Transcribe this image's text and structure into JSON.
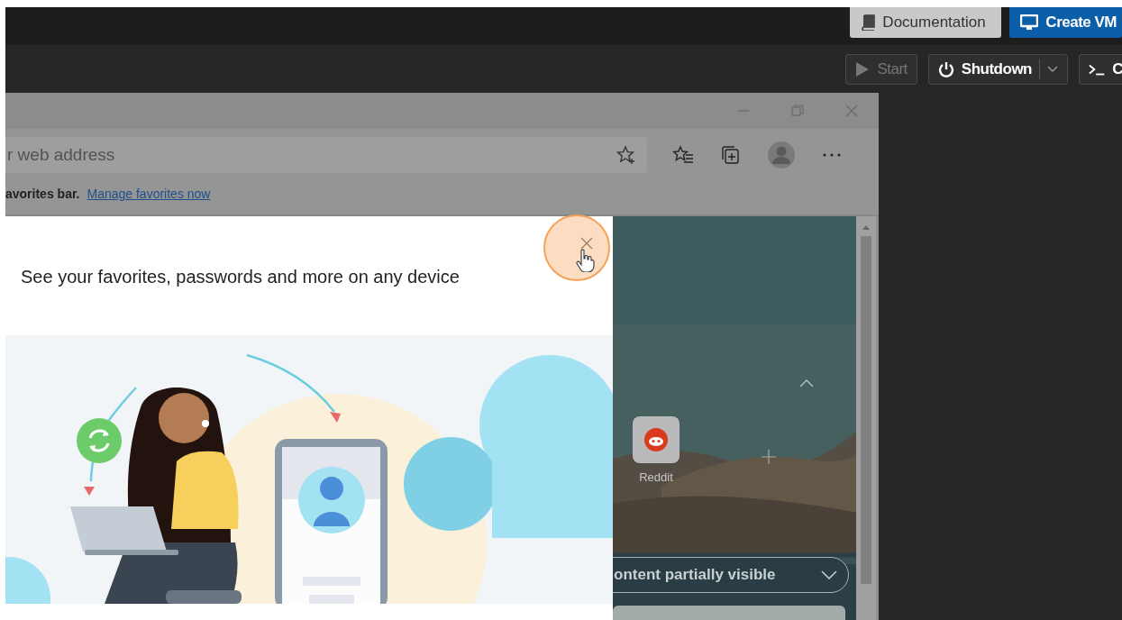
{
  "top_bar": {
    "buttons": [
      {
        "label": "Documentation",
        "kind": "secondary"
      },
      {
        "label": "Create VM",
        "kind": "primary"
      }
    ]
  },
  "toolbar": {
    "buttons": [
      {
        "label": "Start",
        "disabled": true,
        "kind": "start"
      },
      {
        "label": "Shutdown",
        "disabled": false,
        "kind": "split"
      },
      {
        "label": "C",
        "disabled": false,
        "kind": "console"
      }
    ]
  },
  "browser": {
    "address_bar": {
      "placeholder": "r web address"
    },
    "favorites_bar": {
      "message": "avorites bar.",
      "link": "Manage favorites now"
    },
    "dialog": {
      "title": "See your favorites, passwords and more on any device"
    },
    "new_tab": {
      "tiles": [
        {
          "label": "Reddit"
        }
      ],
      "content_menu": "ontent partially visible"
    }
  }
}
